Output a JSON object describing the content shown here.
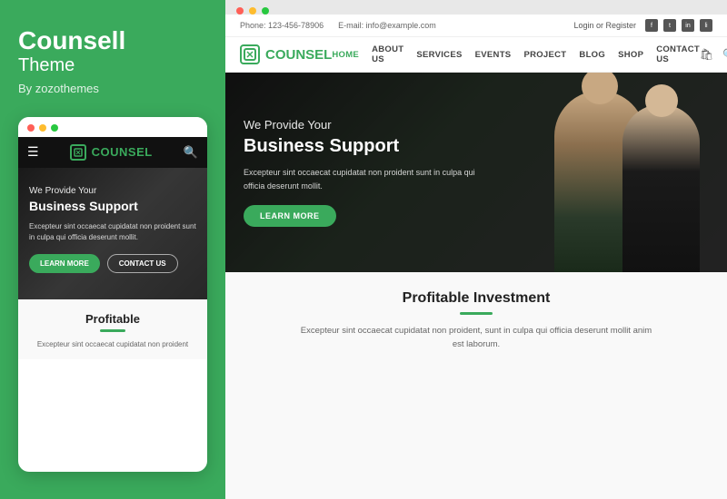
{
  "left": {
    "title": "Counsell",
    "subtitle": "Theme",
    "author": "By zozothemes",
    "mobile": {
      "dots": [
        "red",
        "yellow",
        "green"
      ],
      "logo_text_main": "COUN",
      "logo_text_accent": "SEL",
      "hero_subtitle": "We Provide Your",
      "hero_title": "Business Support",
      "hero_text": "Excepteur sint occaecat cupidatat non proident sunt in culpa qui officia deserunt mollit.",
      "btn_learn": "LEARN MORE",
      "btn_contact": "CONTACT US",
      "section_title": "Profitable",
      "section_text": "Excepteur sint occaecat cupidatat non proident"
    }
  },
  "right": {
    "browser_dots": [
      "red",
      "yellow",
      "green"
    ],
    "infobar": {
      "phone": "Phone: 123-456-78906",
      "email": "E-mail: info@example.com",
      "login_register": "Login or Register"
    },
    "nav": {
      "logo_main": "COUN",
      "logo_accent": "SEL",
      "links": [
        {
          "label": "HOME",
          "active": true
        },
        {
          "label": "ABOUT US",
          "active": false
        },
        {
          "label": "SERVICES",
          "active": false
        },
        {
          "label": "EVENTS",
          "active": false
        },
        {
          "label": "PROJECT",
          "active": false
        },
        {
          "label": "BLOG",
          "active": false
        },
        {
          "label": "SHOP",
          "active": false
        },
        {
          "label": "CONTACT US",
          "active": false
        }
      ]
    },
    "hero": {
      "headline": "We Provide Your",
      "title": "Business Support",
      "text": "Excepteur sint occaecat cupidatat non proident sunt in culpa qui officia deserunt mollit.",
      "btn_label": "LEARN MORE"
    },
    "bottom": {
      "title": "Profitable Investment",
      "text": "Excepteur sint occaecat cupidatat non proident, sunt in culpa qui officia deserunt mollit anim est laborum."
    }
  }
}
